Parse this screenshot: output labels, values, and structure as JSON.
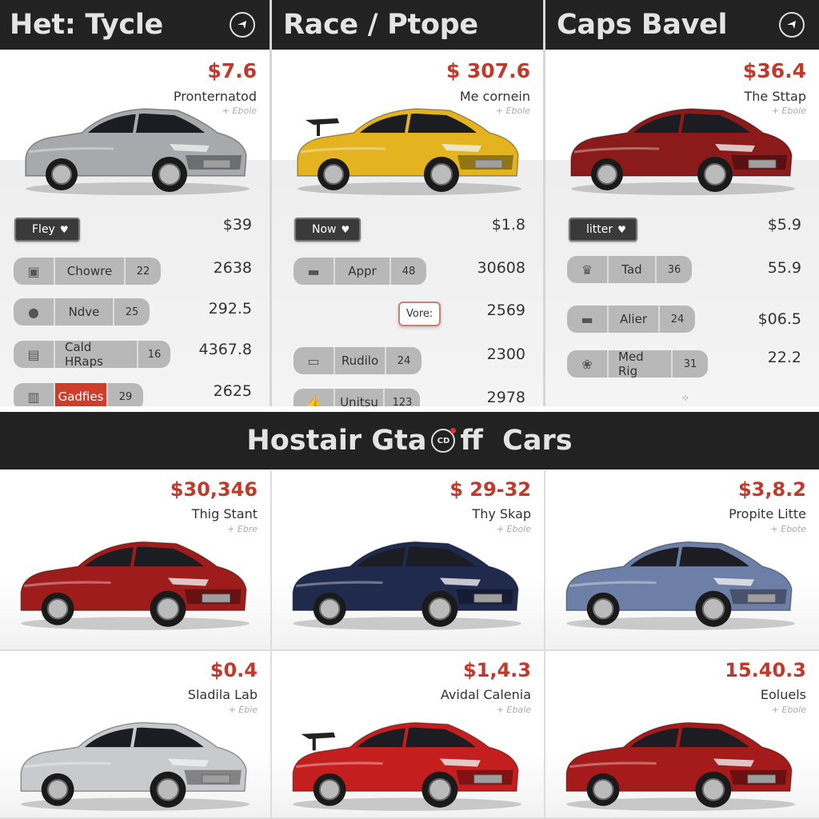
{
  "columns": [
    {
      "title": "Het: Tycle",
      "header_icon": "arrow-icon",
      "price": "$7.6",
      "name": "Pronternatod",
      "sub": "+ Ebole",
      "car_color": "#a8a9ad",
      "dropdown": "Fley",
      "dropdown_value": "$39",
      "rows": [
        {
          "icon": "box-icon",
          "label": "Chowre",
          "count": "22",
          "value": "2638"
        },
        {
          "icon": "person-icon",
          "label": "Ndve",
          "count": "25",
          "value": "292.5"
        },
        {
          "icon": "folder-icon",
          "label": "Cald HRaps",
          "count": "16",
          "value": "4367.8"
        },
        {
          "icon": "bars-icon",
          "label": "Gadfies",
          "count": "29",
          "value": "2625",
          "highlight": true
        }
      ]
    },
    {
      "title": "Race / Ptope",
      "price": "$ 307.6",
      "name": "Me cornein",
      "sub": "+ Ebole",
      "car_color": "#e3b420",
      "dropdown": "Now",
      "dropdown_value": "$1.8",
      "tooltip": "Vore:",
      "rows": [
        {
          "icon": "seat-icon",
          "label": "Appr",
          "count": "48",
          "value": "30608"
        },
        {
          "icon": "",
          "label": "",
          "count": "",
          "value": "2569"
        },
        {
          "icon": "card-icon",
          "label": "Rudilo",
          "count": "24",
          "value": "2300"
        },
        {
          "icon": "thumb-icon",
          "label": "Unitsu",
          "count": "123",
          "value": "2978"
        }
      ]
    },
    {
      "title": "Caps Bavel",
      "header_icon": "arrow-icon",
      "price": "$36.4",
      "name": "The Sttap",
      "sub": "+ Ebole",
      "car_color": "#8b1a1a",
      "dropdown": "litter",
      "dropdown_value": "$5.9",
      "rows": [
        {
          "icon": "crown-icon",
          "label": "Tad",
          "count": "36",
          "value": "55.9"
        },
        {
          "icon": "sofa-icon",
          "label": "Alier",
          "count": "24",
          "value": "$06.5"
        },
        {
          "icon": "blob-icon",
          "label": "Med Rig",
          "count": "31",
          "value": "22.2"
        }
      ]
    }
  ],
  "banner": {
    "left": "Hostair Gta",
    "logo": "CD",
    "right": "ff  Cars"
  },
  "cards": [
    {
      "price": "$30,346",
      "name": "Thig Stant",
      "sub": "+ Ebre",
      "car_color": "#9e1c1c"
    },
    {
      "price": "$ 29-32",
      "name": "Thy Skap",
      "sub": "+ Ebole",
      "car_color": "#1f2a4d"
    },
    {
      "price": "$3,8.2",
      "name": "Propite Litte",
      "sub": "+ Ebote",
      "car_color": "#6d7fa6"
    },
    {
      "price": "$0.4",
      "name": "Sladila Lab",
      "sub": "+ Ebie",
      "car_color": "#c9cace"
    },
    {
      "price": "$1,4.3",
      "name": "Avidal Calenia",
      "sub": "+ Ebale",
      "car_color": "#c41e1e"
    },
    {
      "price": "15.40.3",
      "name": "Eoluels",
      "sub": "+ Ebole",
      "car_color": "#a51a1a"
    }
  ],
  "colors": {
    "accent_price": "#c0392b",
    "header_bg": "#222222",
    "highlight": "#cc3d2a"
  }
}
